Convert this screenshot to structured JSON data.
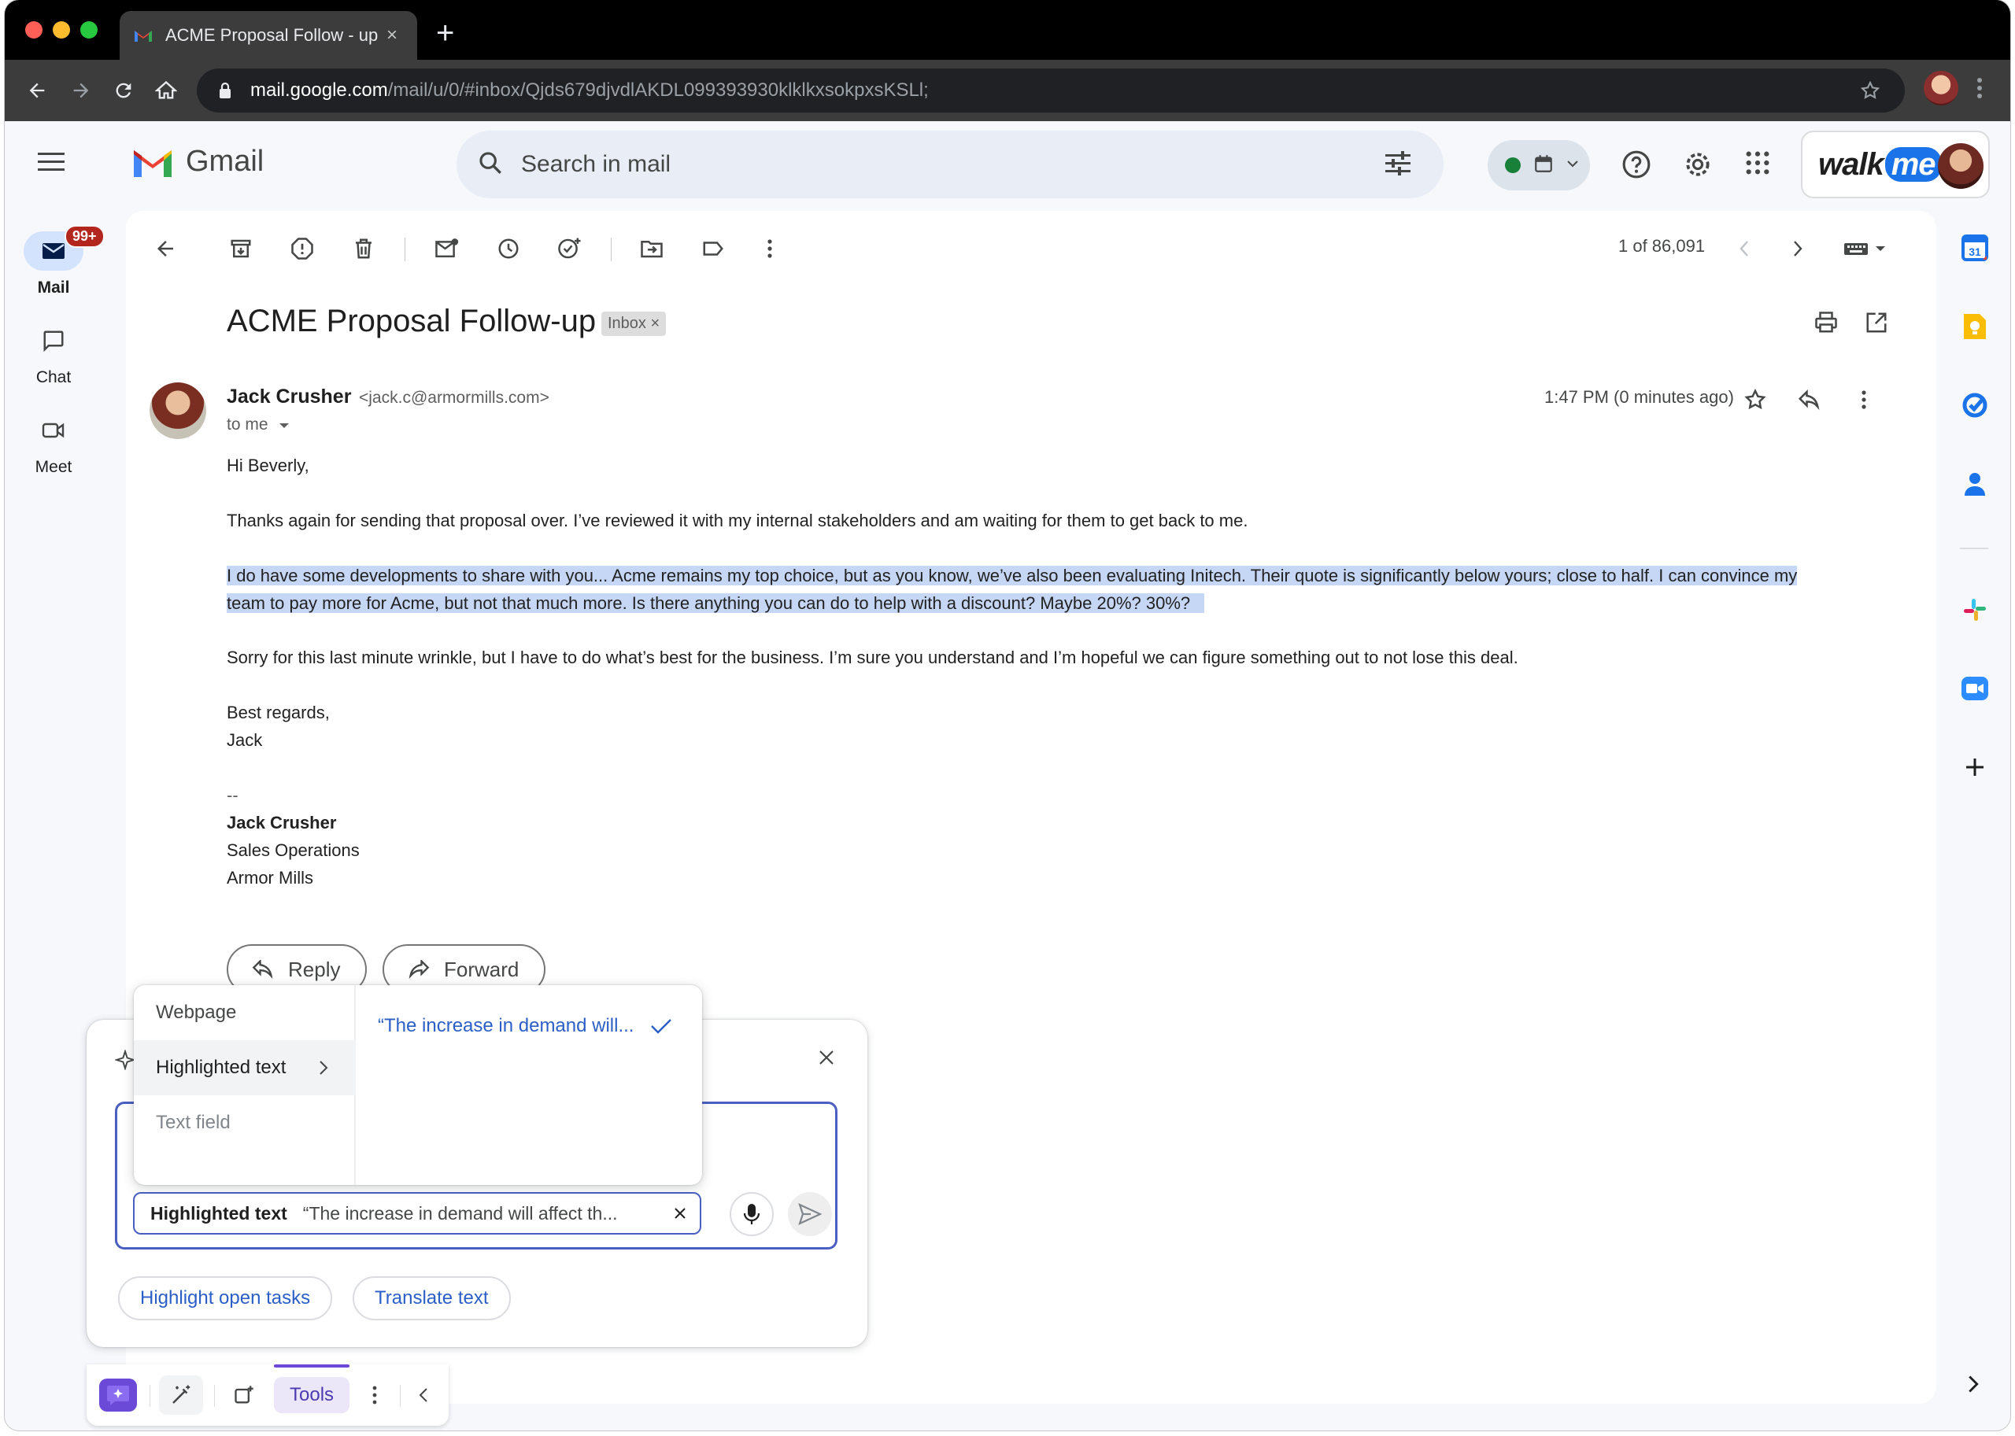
{
  "browser": {
    "tab_title": "ACME Proposal Follow - up",
    "tab_close": "×",
    "new_tab": "+",
    "url_host": "mail.google.com",
    "url_path": "/mail/u/0/#inbox/Qjds679djvdlAKDL099393930klklkxsokpxsKSLl;"
  },
  "gmail": {
    "brand": "Gmail",
    "search_placeholder": "Search in mail",
    "walkme_a": "walk",
    "walkme_b": "me"
  },
  "rail": {
    "mail_label": "Mail",
    "mail_badge": "99+",
    "chat_label": "Chat",
    "meet_label": "Meet"
  },
  "toolbar": {
    "pager": "1 of 86,091"
  },
  "email": {
    "subject": "ACME Proposal Follow-up",
    "label_chip": "Inbox ×",
    "sender_name": "Jack Crusher",
    "sender_email": "<jack.c@armormills.com>",
    "recipient": "to me",
    "time": "1:47 PM (0 minutes ago)",
    "greeting": "Hi Beverly,",
    "para1": "Thanks again for sending that proposal over. I’ve reviewed it with my internal stakeholders and am waiting for them to get back to me.",
    "para2_line1": "I do have some developments to share with you... Acme remains my top choice, but as you know, we’ve also been evaluating Initech. Their quote is significantly below yours; close to half. I can convince my",
    "para2_line2": "team to pay more for Acme, but not that much more. Is there anything you can do to help with a discount? Maybe 20%? 30%?",
    "para3": "Sorry for this last minute wrinkle, but I have to do what’s best for the business. I’m sure you understand and I’m hopeful we can figure something out to not lose this deal.",
    "signoff1": "Best regards,",
    "signoff2": "Jack",
    "sig_dash": "--",
    "sig_name": "Jack Crusher",
    "sig_title": "Sales Operations",
    "sig_company": "Armor Mills",
    "reply_label": "Reply",
    "forward_label": "Forward"
  },
  "ai_panel": {
    "context_menu": {
      "items": [
        "Webpage",
        "Highlighted text",
        "Text field"
      ],
      "selected_value": "“The increase in demand will..."
    },
    "chip_label": "Highlighted text",
    "chip_value": "“The increase in demand will affect th...",
    "suggestions": [
      "Highlight open tasks",
      "Translate text"
    ]
  },
  "bottom_bar": {
    "tools_label": "Tools"
  },
  "colors": {
    "accent": "#4a5fc1",
    "highlight": "#c6d6f5",
    "ai_purple": "#6c4ad8",
    "badge_red": "#b3261e"
  }
}
